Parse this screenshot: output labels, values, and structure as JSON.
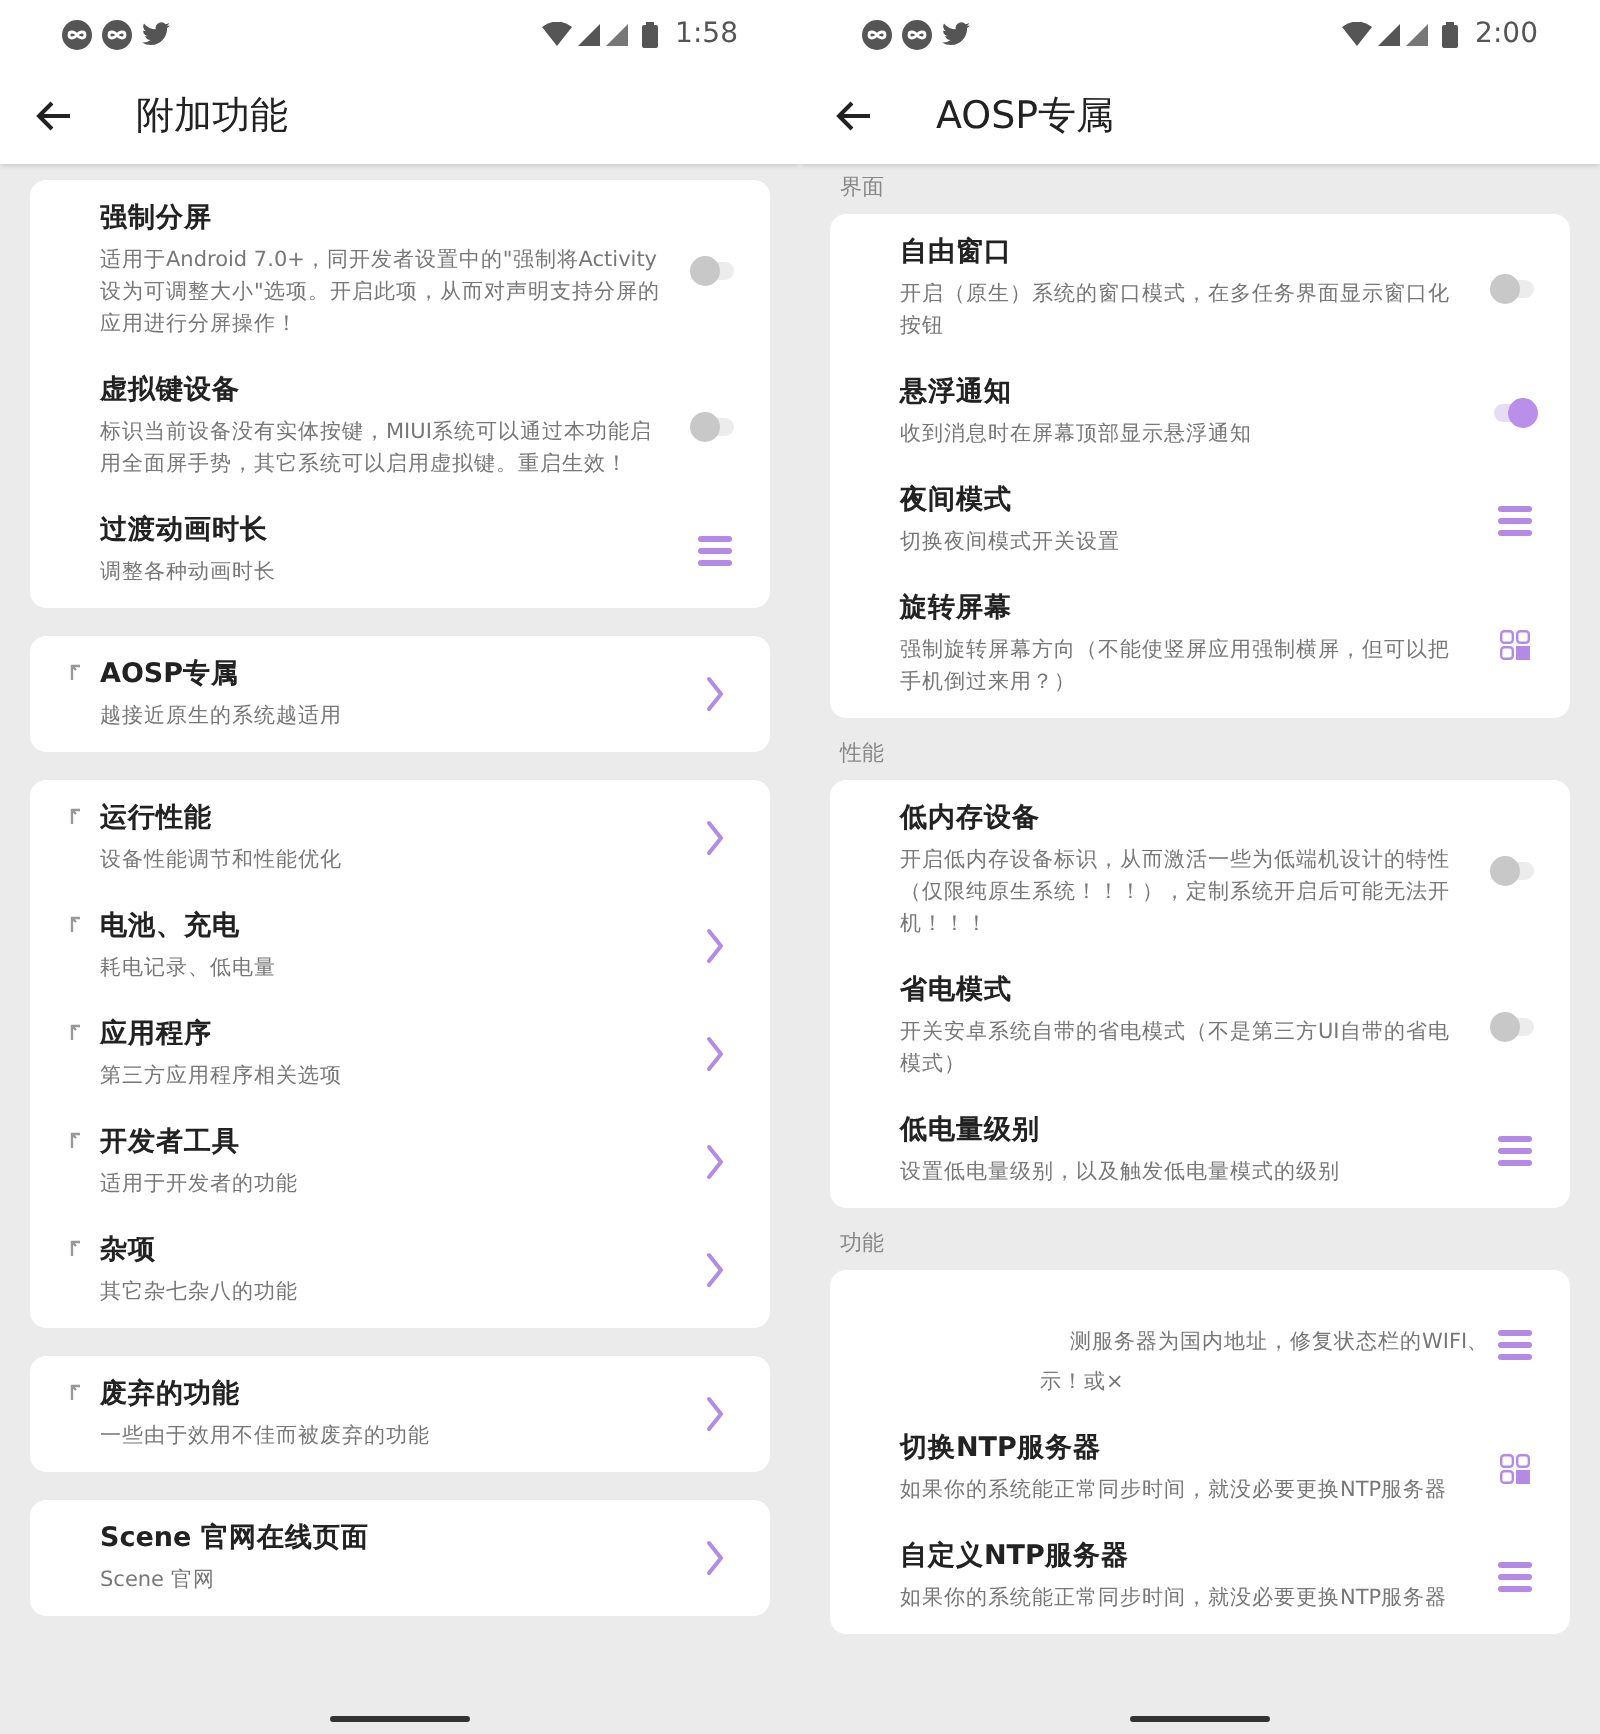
{
  "panels": [
    {
      "status_time": "1:58",
      "title": "附加功能",
      "sections": [
        {
          "cards": [
            {
              "items": [
                {
                  "kind": "toggle",
                  "on": false,
                  "title": "强制分屏",
                  "description": "适用于Android 7.0+，同开发者设置中的\"强制将Activity设为可调整大小\"选项。开启此项，从而对声明支持分屏的应用进行分屏操作！"
                },
                {
                  "kind": "toggle",
                  "on": false,
                  "title": "虚拟键设备",
                  "description": "标识当前设备没有实体按键，MIUI系统可以通过本功能启用全面屏手势，其它系统可以启用虚拟键。重启生效！"
                },
                {
                  "kind": "menu",
                  "title": "过渡动画时长",
                  "description": "调整各种动画时长"
                }
              ]
            },
            {
              "items": [
                {
                  "kind": "link",
                  "title": "AOSP专属",
                  "description": "越接近原生的系统越适用"
                }
              ]
            },
            {
              "items": [
                {
                  "kind": "link",
                  "title": "运行性能",
                  "description": "设备性能调节和性能优化"
                },
                {
                  "kind": "link",
                  "title": "电池、充电",
                  "description": "耗电记录、低电量"
                },
                {
                  "kind": "link",
                  "title": "应用程序",
                  "description": "第三方应用程序相关选项"
                },
                {
                  "kind": "link",
                  "title": "开发者工具",
                  "description": "适用于开发者的功能"
                },
                {
                  "kind": "link",
                  "title": "杂项",
                  "description": "其它杂七杂八的功能"
                }
              ]
            },
            {
              "items": [
                {
                  "kind": "link",
                  "title": "废弃的功能",
                  "description": "一些由于效用不佳而被废弃的功能"
                }
              ]
            },
            {
              "items": [
                {
                  "kind": "plain-link",
                  "title": "Scene 官网在线页面",
                  "description": "Scene 官网"
                }
              ]
            }
          ]
        }
      ]
    },
    {
      "status_time": "2:00",
      "title": "AOSP专属",
      "sections": [
        {
          "header": "界面",
          "cards": [
            {
              "items": [
                {
                  "kind": "toggle",
                  "on": false,
                  "title": "自由窗口",
                  "description": "开启（原生）系统的窗口模式，在多任务界面显示窗口化按钮"
                },
                {
                  "kind": "toggle",
                  "on": true,
                  "title": "悬浮通知",
                  "description": "收到消息时在屏幕顶部显示悬浮通知"
                },
                {
                  "kind": "menu",
                  "title": "夜间模式",
                  "description": "切换夜间模式开关设置"
                },
                {
                  "kind": "grid",
                  "title": "旋转屏幕",
                  "description": "强制旋转屏幕方向（不能使竖屏应用强制横屏，但可以把手机倒过来用？）"
                }
              ]
            }
          ]
        },
        {
          "header": "性能",
          "cards": [
            {
              "items": [
                {
                  "kind": "toggle",
                  "on": false,
                  "title": "低内存设备",
                  "description": "开启低内存设备标识，从而激活一些为低端机设计的特性（仅限纯原生系统！！！），定制系统开启后可能无法开机！！！"
                },
                {
                  "kind": "toggle",
                  "on": false,
                  "title": "省电模式",
                  "description": "开关安卓系统自带的省电模式（不是第三方UI自带的省电模式）"
                },
                {
                  "kind": "menu",
                  "title": "低电量级别",
                  "description": "设置低电量级别，以及触发低电量模式的级别"
                }
              ]
            }
          ]
        },
        {
          "header": "功能",
          "cards": [
            {
              "items": [
                {
                  "kind": "menu",
                  "fragments": [
                    "测服务器为国内地址，修复状态栏的WIFI、",
                    "示！或×"
                  ]
                },
                {
                  "kind": "grid",
                  "title": "切换NTP服务器",
                  "description": "如果你的系统能正常同步时间，就没必要更换NTP服务器"
                },
                {
                  "kind": "menu",
                  "title": "自定义NTP服务器",
                  "description": "如果你的系统能正常同步时间，就没必要更换NTP服务器"
                }
              ]
            }
          ]
        }
      ]
    }
  ]
}
